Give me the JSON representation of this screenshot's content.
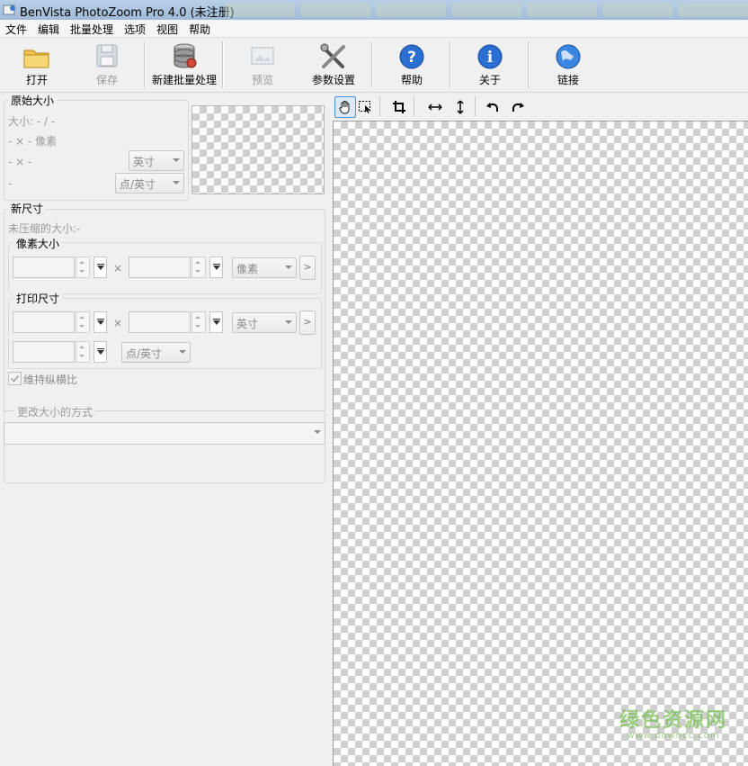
{
  "window": {
    "title": "BenVista PhotoZoom Pro 4.0 (未注册)"
  },
  "menu": [
    "文件",
    "编辑",
    "批量处理",
    "选项",
    "视图",
    "帮助"
  ],
  "toolbar": {
    "open": "打开",
    "save": "保存",
    "new_batch": "新建批量处理",
    "preview": "预览",
    "settings": "参数设置",
    "help": "帮助",
    "about": "关于",
    "link": "链接"
  },
  "original_size": {
    "title": "原始大小",
    "size_text": "大小: - / -",
    "pixels_text": "- × - 像素",
    "dims_text": "- × -",
    "res_text": "-",
    "unit_select": "英寸",
    "res_select": "点/英寸"
  },
  "new_size": {
    "title": "新尺寸",
    "uncompressed": "未压缩的大小:-",
    "pixel_size": {
      "title": "像素大小",
      "unit_select": "像素",
      "times": "×",
      "arrow": ">"
    },
    "print_size": {
      "title": "打印尺寸",
      "unit_select": "英寸",
      "res_select": "点/英寸",
      "times": "×",
      "arrow": ">"
    },
    "keep_aspect": "维持纵横比"
  },
  "resize_method": {
    "title": "更改大小的方式",
    "value": ""
  },
  "watermark": {
    "main": "绿色资源网",
    "sub": "www.downcc.com"
  }
}
